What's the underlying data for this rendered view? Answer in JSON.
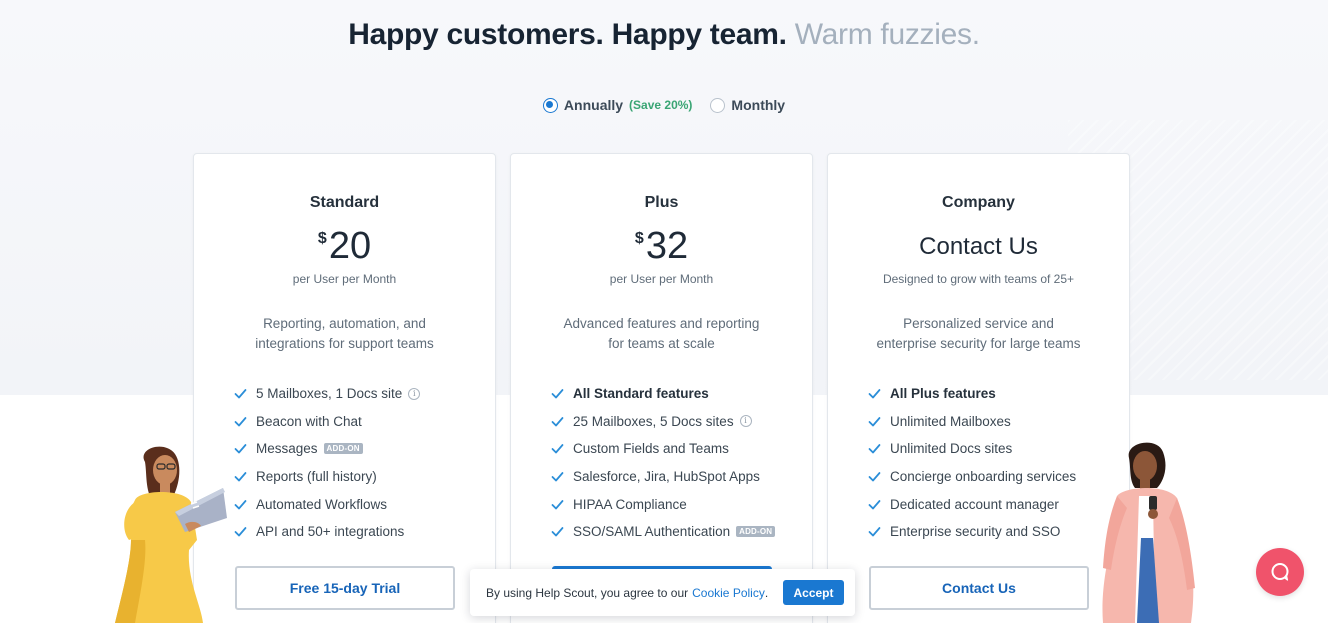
{
  "header": {
    "headline_main": "Happy customers. Happy team.",
    "headline_muted": "Warm fuzzies."
  },
  "billing": {
    "annual_label": "Annually",
    "annual_note": "(Save 20%)",
    "monthly_label": "Monthly",
    "selected": "annually"
  },
  "plans": [
    {
      "name": "Standard",
      "currency": "$",
      "price": "20",
      "per": "per User per Month",
      "desc_line1": "Reporting, automation, and",
      "desc_line2": "integrations for support teams",
      "features": [
        {
          "label": "5 Mailboxes, 1 Docs site",
          "tag": "info"
        },
        {
          "label": "Beacon with Chat"
        },
        {
          "label": "Messages",
          "tag": "ADD-ON"
        },
        {
          "label": "Reports (full history)"
        },
        {
          "label": "Automated Workflows"
        },
        {
          "label": "API and 50+ integrations"
        }
      ],
      "cta": "Free 15-day Trial"
    },
    {
      "name": "Plus",
      "currency": "$",
      "price": "32",
      "per": "per User per Month",
      "desc_line1": "Advanced features and reporting",
      "desc_line2": "for teams at scale",
      "features": [
        {
          "label": "All Standard features",
          "strong": true
        },
        {
          "label": "25 Mailboxes, 5 Docs sites",
          "tag": "info"
        },
        {
          "label": "Custom Fields and Teams"
        },
        {
          "label": "Salesforce, Jira, HubSpot Apps"
        },
        {
          "label": "HIPAA Compliance"
        },
        {
          "label": "SSO/SAML Authentication",
          "tag": "ADD-ON"
        }
      ],
      "cta": ""
    },
    {
      "name": "Company",
      "price_text": "Contact Us",
      "per": "Designed to grow with teams of 25+",
      "desc_line1": "Personalized service and",
      "desc_line2": "enterprise security for large teams",
      "features": [
        {
          "label": "All Plus features",
          "strong": true
        },
        {
          "label": "Unlimited Mailboxes"
        },
        {
          "label": "Unlimited Docs sites"
        },
        {
          "label": "Concierge onboarding services"
        },
        {
          "label": "Dedicated account manager"
        },
        {
          "label": "Enterprise security and SSO"
        }
      ],
      "cta": "Contact Us"
    }
  ],
  "cookie_banner": {
    "text": "By using Help Scout, you agree to our",
    "link": "Cookie Policy",
    "period": ".",
    "accept": "Accept"
  },
  "icons": {
    "check": "check-icon",
    "info": "info-icon",
    "beacon": "chat-bubble-icon"
  },
  "colors": {
    "accent": "#1a78d1",
    "save_green": "#3aa574",
    "beacon": "#f0536b",
    "check": "#2b8ed8"
  }
}
